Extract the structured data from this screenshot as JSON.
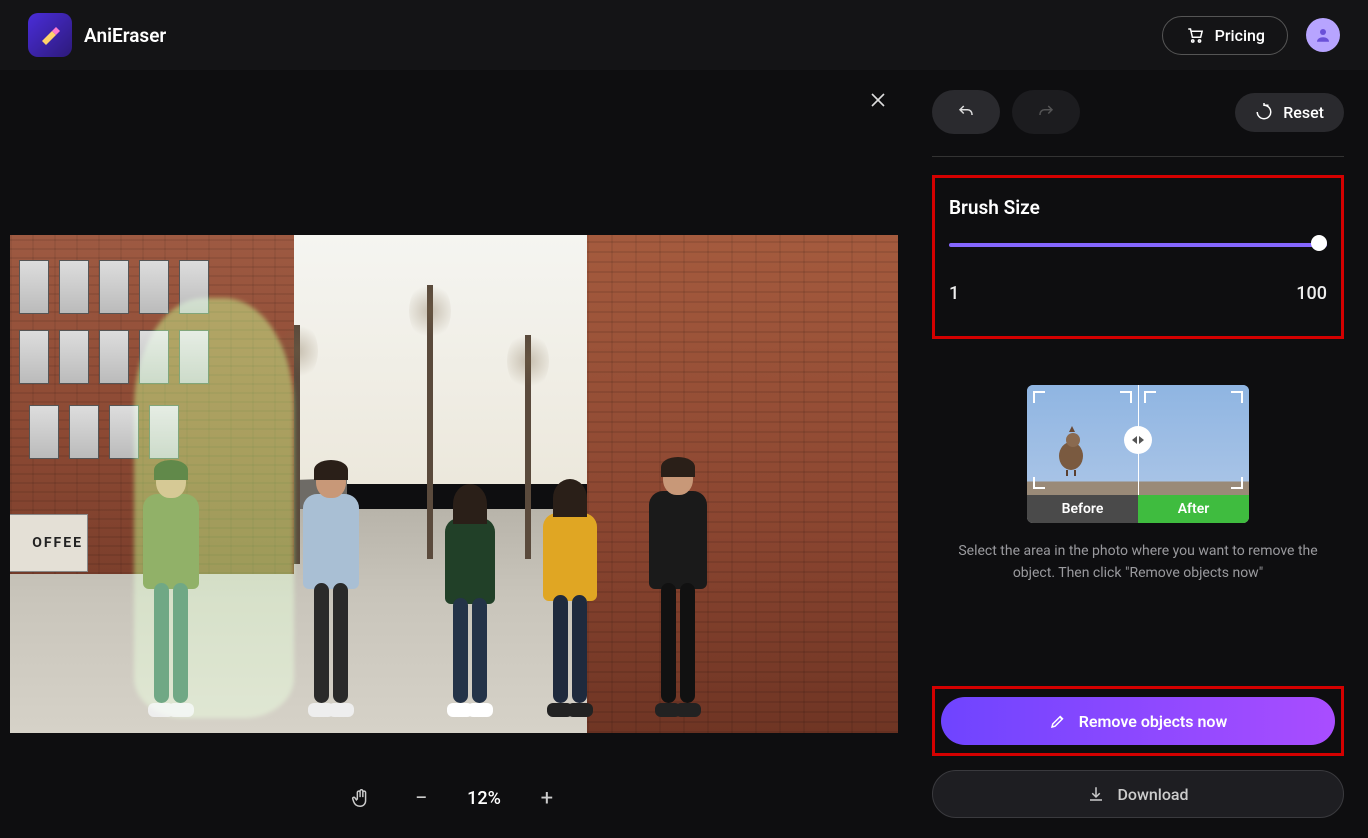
{
  "header": {
    "app_name": "AniEraser",
    "pricing_label": "Pricing"
  },
  "canvas": {
    "zoom_label": "12%"
  },
  "sidebar": {
    "reset_label": "Reset",
    "brush": {
      "title": "Brush Size",
      "min": "1",
      "max": "100"
    },
    "preview": {
      "before_label": "Before",
      "after_label": "After"
    },
    "hint": "Select the area in the photo where you want to remove the object. Then click \"Remove objects now\"",
    "primary_label": "Remove objects now",
    "download_label": "Download"
  },
  "photo": {
    "coffee_sign": "OFFEE"
  }
}
